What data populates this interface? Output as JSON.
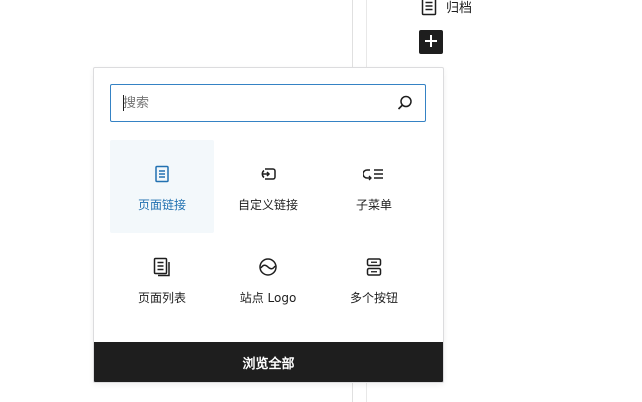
{
  "sidebar": {
    "archive_label": "归档",
    "archive_icon": "page-icon",
    "add_icon": "plus-icon"
  },
  "inserter": {
    "search": {
      "placeholder": "搜索",
      "value": "",
      "icon": "search-icon"
    },
    "blocks": [
      {
        "label": "页面链接",
        "icon": "page-icon",
        "active": true
      },
      {
        "label": "自定义链接",
        "icon": "custom-link-icon",
        "active": false
      },
      {
        "label": "子菜单",
        "icon": "submenu-icon",
        "active": false
      },
      {
        "label": "页面列表",
        "icon": "pages-icon",
        "active": false
      },
      {
        "label": "站点 Logo",
        "icon": "site-logo-icon",
        "active": false
      },
      {
        "label": "多个按钮",
        "icon": "buttons-icon",
        "active": false
      }
    ],
    "browse_all_label": "浏览全部"
  },
  "colors": {
    "accent": "#2271b1",
    "focus_border": "#3582c4",
    "dark": "#1e1e1e",
    "active_bg": "#f3f8fb"
  }
}
